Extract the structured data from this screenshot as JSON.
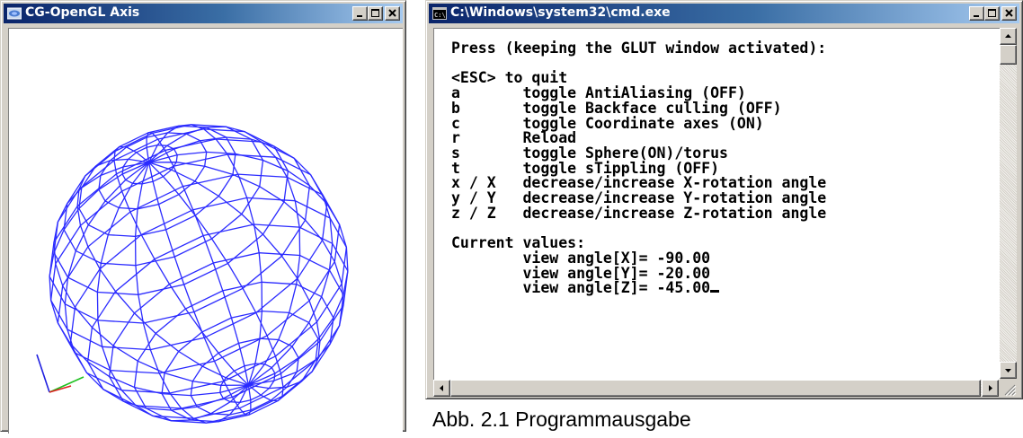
{
  "gl_window": {
    "title": "CG-OpenGL Axis",
    "controls": {
      "minimize": "minimize",
      "maximize": "maximize",
      "close": "close"
    }
  },
  "cmd_window": {
    "title": "C:\\Windows\\system32\\cmd.exe",
    "icon_text": "C:\\",
    "console_lines": [
      "Press (keeping the GLUT window activated):",
      "",
      "<ESC> to quit",
      "a       toggle AntiAliasing (OFF)",
      "b       toggle Backface culling (OFF)",
      "c       toggle Coordinate axes (ON)",
      "r       Reload",
      "s       toggle Sphere(ON)/torus",
      "t       toggle sTippling (OFF)",
      "x / X   decrease/increase X-rotation angle",
      "y / Y   decrease/increase Y-rotation angle",
      "z / Z   decrease/increase Z-rotation angle",
      "",
      "Current values:",
      "        view angle[X]= -90.00",
      "        view angle[Y]= -20.00",
      "        view angle[Z]= -45.00"
    ]
  },
  "caption": "Abb. 2.1 Programmausgabe",
  "colors": {
    "wireframe": "#2b2bff",
    "axis_x": "#e02020",
    "axis_y": "#20c020",
    "axis_z": "#2020e0"
  }
}
